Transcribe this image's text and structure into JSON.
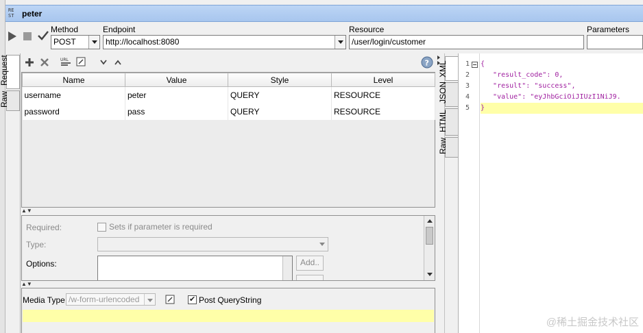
{
  "window": {
    "title": "peter",
    "icon": "rest-icon",
    "icon_text": "RE\nST"
  },
  "toolbar": {
    "method_label": "Method",
    "method_value": "POST",
    "endpoint_label": "Endpoint",
    "endpoint_value": "http://localhost:8080",
    "resource_label": "Resource",
    "resource_value": "/user/login/customer",
    "parameters_label": "Parameters",
    "parameters_value": ""
  },
  "side_tabs": [
    "Request",
    "Raw"
  ],
  "response_tabs": [
    "XML",
    "JSON",
    "HTML",
    "Raw"
  ],
  "params_table": {
    "columns": [
      "Name",
      "Value",
      "Style",
      "Level"
    ],
    "rows": [
      {
        "name": "username",
        "value": "peter",
        "style": "QUERY",
        "level": "RESOURCE"
      },
      {
        "name": "password",
        "value": "pass",
        "style": "QUERY",
        "level": "RESOURCE"
      }
    ]
  },
  "props": {
    "required_label": "Required:",
    "required_checkbox_label": "Sets if parameter is required",
    "type_label": "Type:",
    "options_label": "Options:",
    "add_button": "Add.."
  },
  "media": {
    "label": "Media Type",
    "value": "/w-form-urlencoded",
    "post_qs_label": "Post QueryString",
    "post_qs_checked": true
  },
  "response": {
    "lines": [
      {
        "num": "1",
        "text": "{"
      },
      {
        "num": "2",
        "text": "   \"result_code\": 0,"
      },
      {
        "num": "3",
        "text": "   \"result\": \"success\","
      },
      {
        "num": "4",
        "text": "   \"value\": \"eyJhbGciOiJIUzI1NiJ9."
      },
      {
        "num": "5",
        "text": "}"
      }
    ],
    "key_color": "#a020a0",
    "string_color": "#a020a0"
  },
  "watermark": "@稀土掘金技术社区"
}
